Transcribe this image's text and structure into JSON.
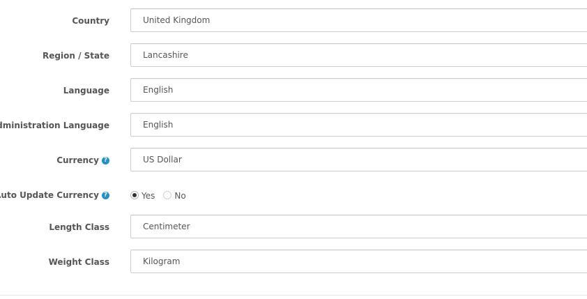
{
  "fields": {
    "country": {
      "label": "Country",
      "value": "United Kingdom"
    },
    "region": {
      "label": "Region / State",
      "value": "Lancashire"
    },
    "language": {
      "label": "Language",
      "value": "English"
    },
    "admin_language": {
      "label": "Administration Language",
      "value": "English"
    },
    "currency": {
      "label": "Currency",
      "value": "US Dollar",
      "help_icon": "question-circle-icon",
      "help_glyph": "?"
    },
    "auto_update_currency": {
      "label": "Auto Update Currency",
      "help_icon": "question-circle-icon",
      "help_glyph": "?",
      "options": [
        "Yes",
        "No"
      ],
      "selected": "Yes"
    },
    "length_class": {
      "label": "Length Class",
      "value": "Centimeter"
    },
    "weight_class": {
      "label": "Weight Class",
      "value": "Kilogram"
    }
  },
  "colors": {
    "label_text": "#555555",
    "help_icon": "#1e91cf",
    "input_border": "#cccccc"
  }
}
